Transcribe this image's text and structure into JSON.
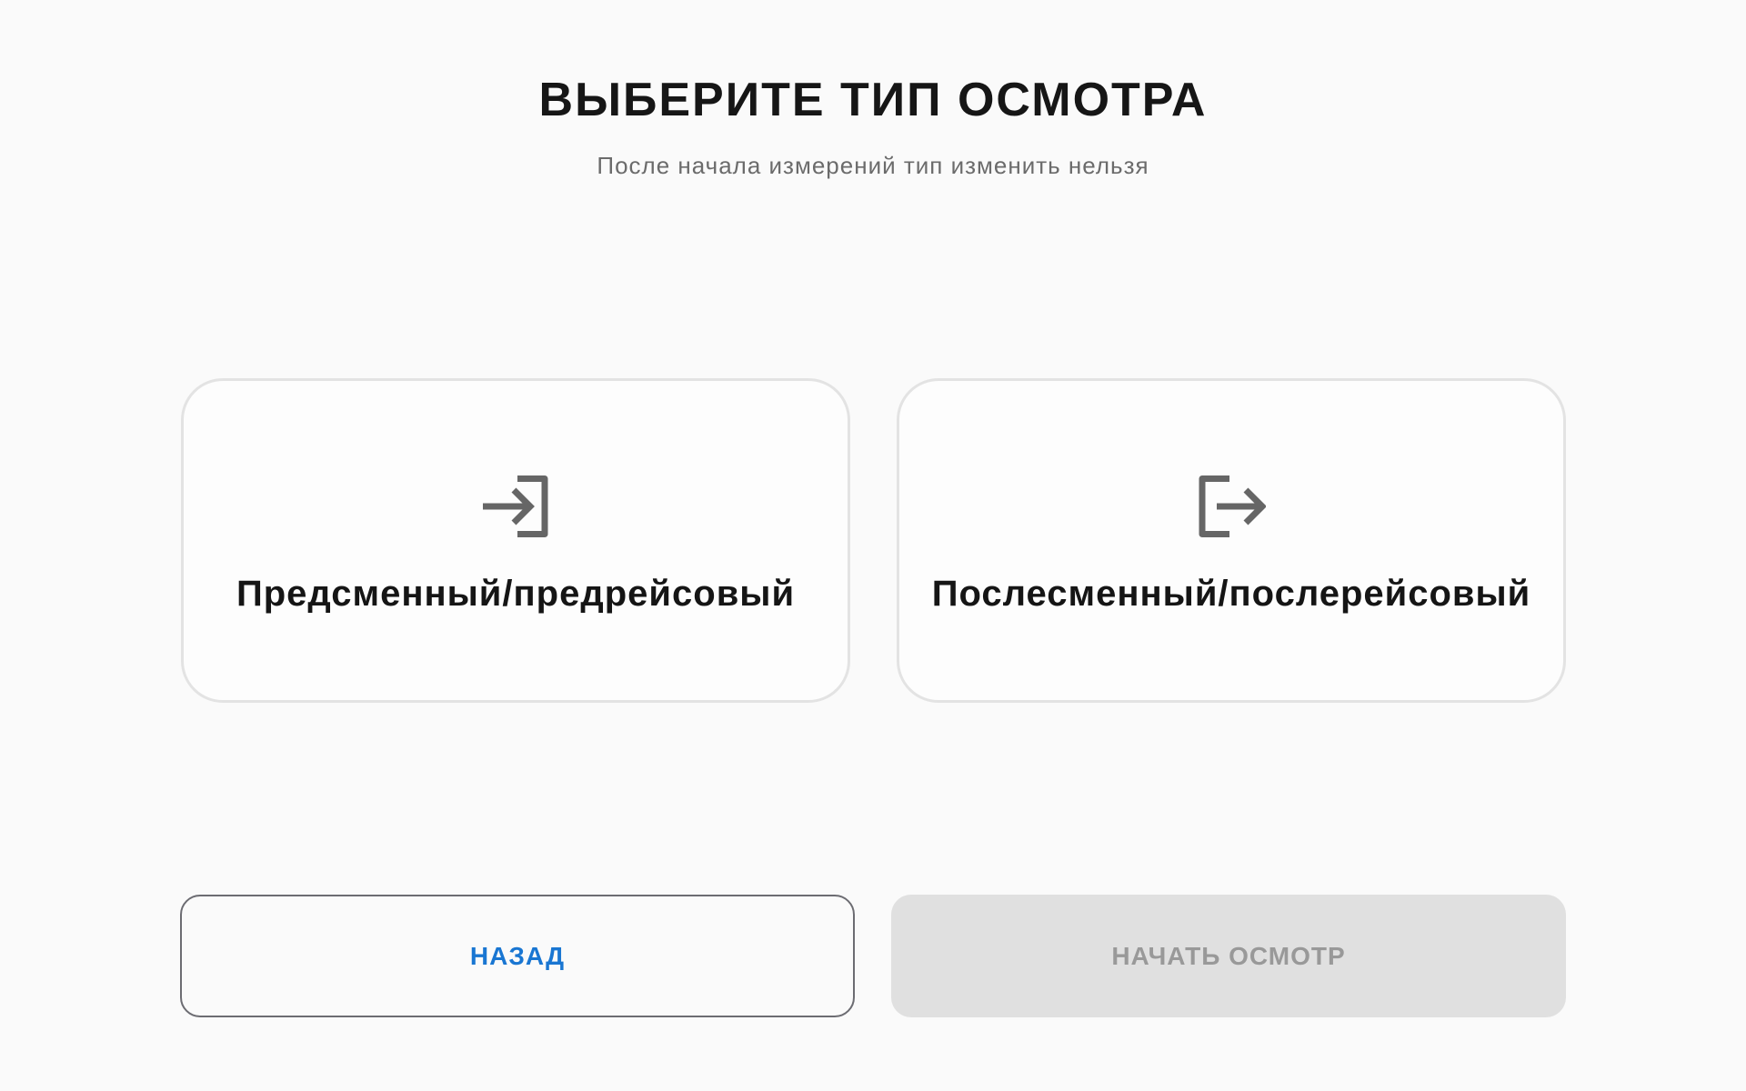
{
  "header": {
    "title": "ВЫБЕРИТЕ ТИП ОСМОТРА",
    "subtitle": "После начала измерений тип изменить нельзя"
  },
  "options": [
    {
      "label": "Предсменный/предрейсовый",
      "icon": "login-icon"
    },
    {
      "label": "Послесменный/послерейсовый",
      "icon": "logout-icon"
    }
  ],
  "actions": {
    "back_label": "НАЗАД",
    "start_label": "НАЧАТЬ ОСМОТР",
    "start_disabled": true
  },
  "colors": {
    "background": "#fafafa",
    "accent": "#1976d2",
    "icon": "#666666",
    "disabled_bg": "#e0e0e0",
    "disabled_text": "#999999"
  }
}
